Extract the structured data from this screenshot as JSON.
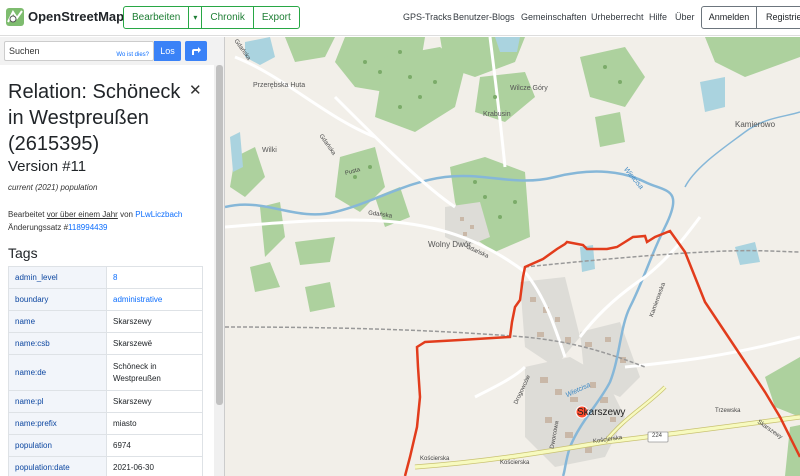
{
  "header": {
    "brand": "OpenStreetMap",
    "edit_label": "Bearbeiten",
    "history_label": "Chronik",
    "export_label": "Export",
    "nav": [
      "GPS-Tracks",
      "Benutzer-Blogs",
      "Gemeinschaften",
      "Urheberrecht",
      "Hilfe",
      "Über"
    ],
    "login_label": "Anmelden",
    "register_label": "Registrieren"
  },
  "search": {
    "placeholder": "Suchen",
    "hint": "Wo ist dies?",
    "go_label": "Los"
  },
  "relation": {
    "title": "Relation: Schöneck in Westpreußen (2615395)",
    "version": "Version #11",
    "description": "current (2021) population",
    "edited_prefix": "Bearbeitet",
    "edited_time": "vor über einem Jahr",
    "edited_by": "von",
    "user": "PLwLiczbach",
    "changeset_label": "Änderungssatz #",
    "changeset": "118994439"
  },
  "tags": {
    "heading": "Tags",
    "rows": [
      {
        "key": "admin_level",
        "value": "8"
      },
      {
        "key": "boundary",
        "value": "administrative"
      },
      {
        "key": "name",
        "value": "Skarszewy"
      },
      {
        "key": "name:csb",
        "value": "Skarszewë"
      },
      {
        "key": "name:de",
        "value": "Schöneck in Westpreußen"
      },
      {
        "key": "name:pl",
        "value": "Skarszewy"
      },
      {
        "key": "name:prefix",
        "value": "miasto"
      },
      {
        "key": "population",
        "value": "6974"
      },
      {
        "key": "population:date",
        "value": "2021-06-30"
      }
    ]
  },
  "map": {
    "labels": {
      "przerebska_huta": "Przerębska Huta",
      "wilcze_gory": "Wilcze Góry",
      "krabusin": "Krabusin",
      "kamierowo": "Kamierowo",
      "wilki": "Wilki",
      "gdanska_1": "Gdańska",
      "gdanska_2": "Gdańska",
      "gdanska_3": "Gdańska",
      "gdanska_4": "Gdańska",
      "pusta": "Pusta",
      "wietcisa_1": "Wietcisa",
      "wietcisa_2": "Wietcisa",
      "wolny_dwor": "Wolny Dwór",
      "kamierowska": "Kamierowska",
      "skarszewy": "Skarszewy",
      "drogowcow": "Drogowców",
      "dworcowa": "Dworcowa",
      "koscierska_1": "Kościerska",
      "koscierska_2": "Kościerska",
      "koscierska_3": "Kościerska",
      "trzewska": "Trzewska",
      "skarszewy_road": "Skarszewy",
      "route_224": "224"
    },
    "colors": {
      "background": "#f2efe9",
      "forest": "#add19e",
      "water": "#aad3df",
      "river": "#6fb0d0",
      "boundary": "#e23c1c",
      "urban": "#dcdcdc",
      "road_yellow": "#f7fabf"
    }
  }
}
